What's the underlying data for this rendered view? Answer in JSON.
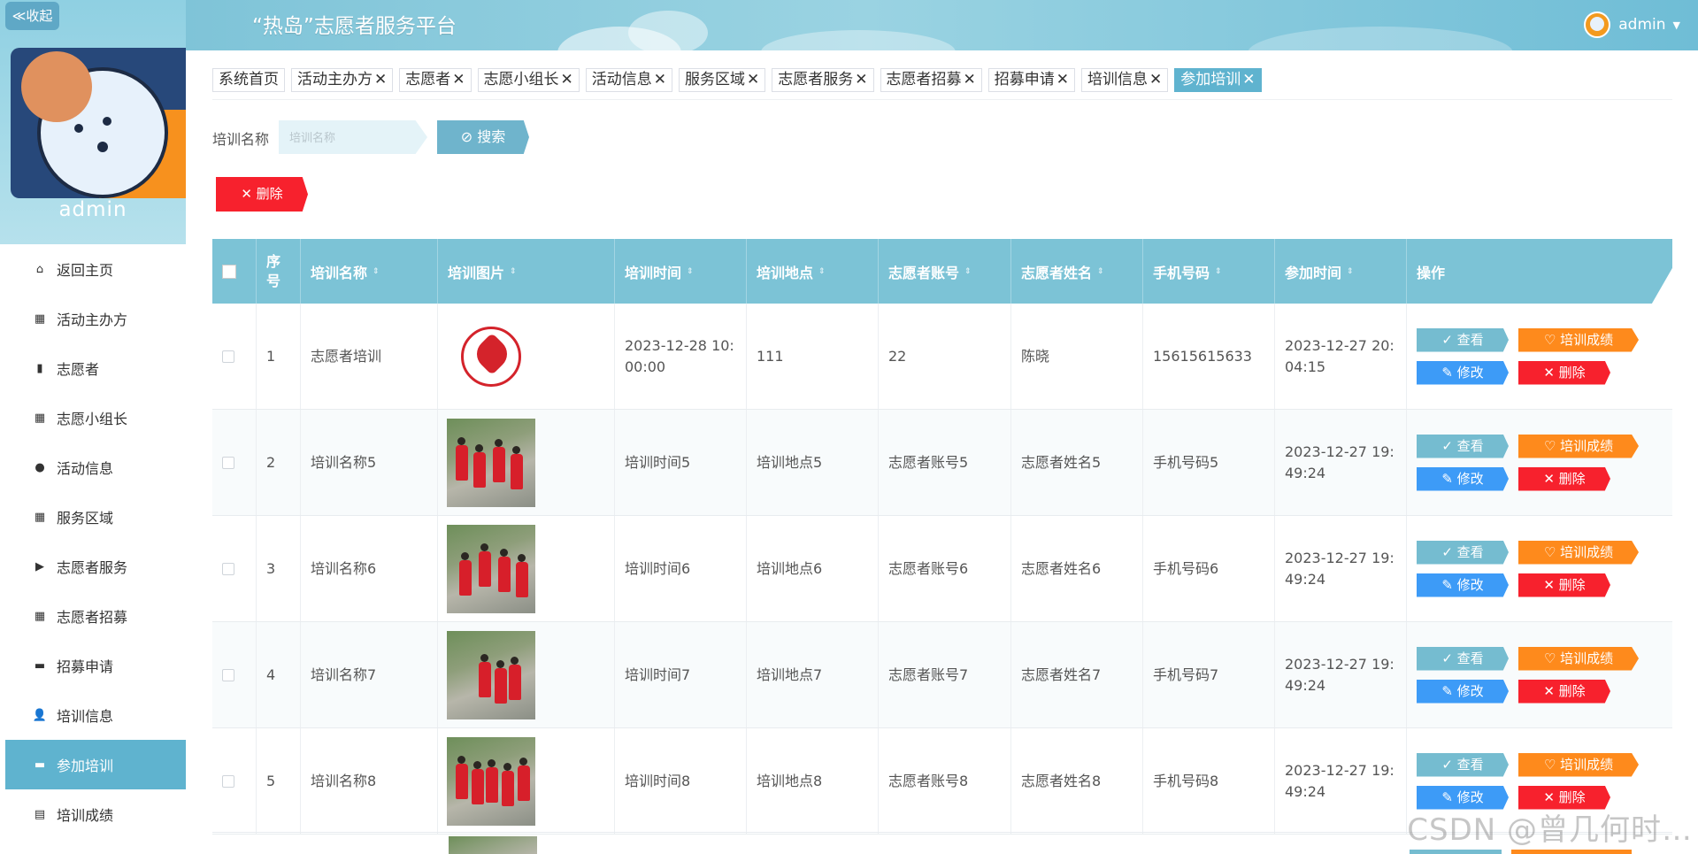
{
  "header": {
    "title": "“热岛”志愿者服务平台",
    "user": "admin"
  },
  "sidebar": {
    "collapse_label": "≪收起",
    "username": "admin",
    "items": [
      {
        "label": "返回主页",
        "icon": "home-icon"
      },
      {
        "label": "活动主办方",
        "icon": "grid-icon"
      },
      {
        "label": "志愿者",
        "icon": "chart-icon"
      },
      {
        "label": "志愿小组长",
        "icon": "grid-icon"
      },
      {
        "label": "活动信息",
        "icon": "bulb-icon"
      },
      {
        "label": "服务区域",
        "icon": "grid-icon"
      },
      {
        "label": "志愿者服务",
        "icon": "video-icon"
      },
      {
        "label": "志愿者招募",
        "icon": "grid-icon"
      },
      {
        "label": "招募申请",
        "icon": "briefcase-icon"
      },
      {
        "label": "培训信息",
        "icon": "user-icon"
      },
      {
        "label": "参加培训",
        "icon": "comment-icon",
        "active": true
      },
      {
        "label": "培训成绩",
        "icon": "clipboard-icon"
      }
    ]
  },
  "tabs": [
    {
      "label": "系统首页",
      "closable": false
    },
    {
      "label": "活动主办方",
      "closable": true
    },
    {
      "label": "志愿者",
      "closable": true
    },
    {
      "label": "志愿小组长",
      "closable": true
    },
    {
      "label": "活动信息",
      "closable": true
    },
    {
      "label": "服务区域",
      "closable": true
    },
    {
      "label": "志愿者服务",
      "closable": true
    },
    {
      "label": "志愿者招募",
      "closable": true
    },
    {
      "label": "招募申请",
      "closable": true
    },
    {
      "label": "培训信息",
      "closable": true
    },
    {
      "label": "参加培训",
      "closable": true,
      "active": true
    }
  ],
  "search": {
    "label": "培训名称",
    "placeholder": "培训名称",
    "button": "搜索"
  },
  "delete_label": "删除",
  "table": {
    "columns": [
      "序号",
      "培训名称",
      "培训图片",
      "培训时间",
      "培训地点",
      "志愿者账号",
      "志愿者姓名",
      "手机号码",
      "参加时间",
      "操作"
    ],
    "rows": [
      {
        "no": "1",
        "name": "志愿者培训",
        "image": "logo",
        "time": "2023-12-28 10:00:00",
        "place": "111",
        "account": "22",
        "vname": "陈晓",
        "phone": "15615615633",
        "join": "2023-12-27 20:04:15"
      },
      {
        "no": "2",
        "name": "培训名称5",
        "image": "photo",
        "time": "培训时间5",
        "place": "培训地点5",
        "account": "志愿者账号5",
        "vname": "志愿者姓名5",
        "phone": "手机号码5",
        "join": "2023-12-27 19:49:24"
      },
      {
        "no": "3",
        "name": "培训名称6",
        "image": "photo",
        "time": "培训时间6",
        "place": "培训地点6",
        "account": "志愿者账号6",
        "vname": "志愿者姓名6",
        "phone": "手机号码6",
        "join": "2023-12-27 19:49:24"
      },
      {
        "no": "4",
        "name": "培训名称7",
        "image": "photo",
        "time": "培训时间7",
        "place": "培训地点7",
        "account": "志愿者账号7",
        "vname": "志愿者姓名7",
        "phone": "手机号码7",
        "join": "2023-12-27 19:49:24"
      },
      {
        "no": "5",
        "name": "培训名称8",
        "image": "photo",
        "time": "培训时间8",
        "place": "培训地点8",
        "account": "志愿者账号8",
        "vname": "志愿者姓名8",
        "phone": "手机号码8",
        "join": "2023-12-27 19:49:24"
      }
    ],
    "actions": {
      "view": "查看",
      "score": "培训成绩",
      "edit": "修改",
      "delete": "删除"
    }
  },
  "watermark": "CSDN @曾几何时…"
}
